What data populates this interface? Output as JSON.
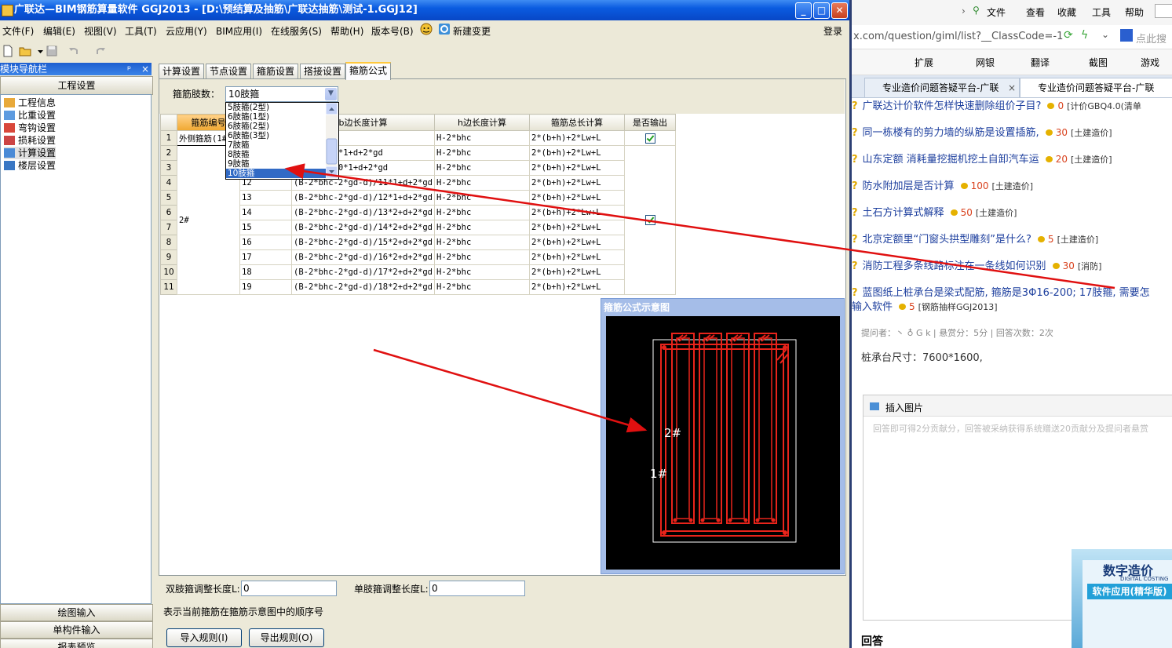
{
  "app": {
    "title": "广联达—BIM钢筋算量软件 GGJ2013 - [D:\\预结算及抽筋\\广联达抽筋\\测试-1.GGJ12]",
    "win_min": "_",
    "win_max": "□",
    "win_close": "✕",
    "menu": [
      "文件(F)",
      "编辑(E)",
      "视图(V)",
      "工具(T)",
      "云应用(Y)",
      "BIM应用(I)",
      "在线服务(S)",
      "帮助(H)",
      "版本号(B)",
      "新建变更"
    ],
    "login": "登录",
    "nav": {
      "header": "模块导航栏",
      "pin": "ᵖ",
      "close": "×",
      "group": "工程设置",
      "items": [
        "工程信息",
        "比重设置",
        "弯钩设置",
        "损耗设置",
        "计算设置",
        "楼层设置"
      ],
      "bottom": [
        "绘图输入",
        "单构件输入",
        "报表预览"
      ]
    },
    "tabs": [
      "计算设置",
      "节点设置",
      "箍筋设置",
      "搭接设置",
      "箍筋公式"
    ],
    "limbs_label": "箍筋肢数：",
    "limbs_value": "10肢箍",
    "dropdown_options": [
      "5肢箍(2型)",
      "6肢箍(1型)",
      "6肢箍(2型)",
      "6肢箍(3型)",
      "7肢箍",
      "8肢箍",
      "9肢箍",
      "10肢箍"
    ],
    "grid": {
      "headers": [
        "箍筋编号",
        "",
        "b边长度计算",
        "h边长度计算",
        "箍筋总长计算",
        "是否输出"
      ],
      "rows": [
        {
          "n": "1",
          "id": "外侧箍筋(1#)",
          "p": "",
          "b": "",
          "h": "H-2*bhc",
          "t": "2*(b+h)+2*Lw+L"
        },
        {
          "n": "2",
          "id": "",
          "p": "",
          "b": "2*gd-d)/9*1+d+2*gd",
          "h": "H-2*bhc",
          "t": "2*(b+h)+2*Lw+L"
        },
        {
          "n": "3",
          "id": "",
          "p": "",
          "b": "2*gd-d)/10*1+d+2*gd",
          "h": "H-2*bhc",
          "t": "2*(b+h)+2*Lw+L"
        },
        {
          "n": "4",
          "id": "",
          "p": "12",
          "b": "(B-2*bhc-2*gd-d)/11*1+d+2*gd",
          "h": "H-2*bhc",
          "t": "2*(b+h)+2*Lw+L"
        },
        {
          "n": "5",
          "id": "",
          "p": "13",
          "b": "(B-2*bhc-2*gd-d)/12*1+d+2*gd",
          "h": "H-2*bhc",
          "t": "2*(b+h)+2*Lw+L"
        },
        {
          "n": "6",
          "id": "2#",
          "p": "14",
          "b": "(B-2*bhc-2*gd-d)/13*2+d+2*gd",
          "h": "H-2*bhc",
          "t": "2*(b+h)+2*Lw+L"
        },
        {
          "n": "7",
          "id": "",
          "p": "15",
          "b": "(B-2*bhc-2*gd-d)/14*2+d+2*gd",
          "h": "H-2*bhc",
          "t": "2*(b+h)+2*Lw+L"
        },
        {
          "n": "8",
          "id": "",
          "p": "16",
          "b": "(B-2*bhc-2*gd-d)/15*2+d+2*gd",
          "h": "H-2*bhc",
          "t": "2*(b+h)+2*Lw+L"
        },
        {
          "n": "9",
          "id": "",
          "p": "17",
          "b": "(B-2*bhc-2*gd-d)/16*2+d+2*gd",
          "h": "H-2*bhc",
          "t": "2*(b+h)+2*Lw+L"
        },
        {
          "n": "10",
          "id": "",
          "p": "18",
          "b": "(B-2*bhc-2*gd-d)/17*2+d+2*gd",
          "h": "H-2*bhc",
          "t": "2*(b+h)+2*Lw+L"
        },
        {
          "n": "11",
          "id": "",
          "p": "19",
          "b": "(B-2*bhc-2*gd-d)/18*2+d+2*gd",
          "h": "H-2*bhc",
          "t": "2*(b+h)+2*Lw+L"
        }
      ]
    },
    "diagram": {
      "title": "箍筋公式示意图",
      "label_outer": "1#",
      "label_inner": "2#"
    },
    "double_adjust_label": "双肢箍调整长度L:",
    "double_adjust_value": "0",
    "single_adjust_label": "单肢箍调整长度L:",
    "single_adjust_value": "0",
    "hint": "表示当前箍筋在箍筋示意图中的顺序号",
    "import_btn": "导入规则(I)",
    "export_btn": "导出规则(O)"
  },
  "browser": {
    "top_menu": [
      "文件",
      "查看",
      "收藏",
      "工具",
      "帮助"
    ],
    "address": "x.com/question/giml/list?__ClassCode=-1",
    "address_right": "点此搜",
    "tools": [
      "扩展",
      "网银",
      "翻译",
      "截图",
      "游戏"
    ],
    "tabs": [
      "专业造价问题答疑平台-广联",
      "专业造价问题答疑平台-广联"
    ],
    "questions": [
      {
        "title": "广联达计价软件怎样快速删除组价子目?",
        "pts": "0",
        "cat": "[计价GBQ4.0(清单"
      },
      {
        "title": "同一栋楼有的剪力墙的纵筋是设置插筋,",
        "pts": "30",
        "cat": "[土建造价]"
      },
      {
        "title": "山东定额 消耗量挖掘机挖土自卸汽车运",
        "pts": "20",
        "cat": "[土建造价]"
      },
      {
        "title": "防水附加层是否计算",
        "pts": "100",
        "cat": "[土建造价]"
      },
      {
        "title": "土石方计算式解释",
        "pts": "50",
        "cat": "[土建造价]"
      },
      {
        "title": "北京定额里“门窗头拱型雕刻”是什么?",
        "pts": "5",
        "cat": "[土建造价]"
      },
      {
        "title": "消防工程多条线路标注在一条线如何识别",
        "pts": "30",
        "cat": "[消防]"
      },
      {
        "title": "蓝图纸上桩承台是梁式配筋, 箍筋是3Φ16-200; 17肢箍, 需要怎",
        "pts": "",
        "cat": ""
      }
    ],
    "q_tail": "输入软件",
    "q_tail_pts": "5",
    "q_tail_cat": "[钢筋抽样GGJ2013]",
    "meta": "提问者：丶 ♁ G k  |  悬赏分：5分  |  回答次数：2次",
    "body": "桩承台尺寸：7600*1600,",
    "insert_image": "插入图片",
    "placeholder": "回答即可得2分贡献分，回答被采纳获得系统赠送20贡献分及提问者悬赏",
    "answer_label": "回答",
    "ad_title": "数字造价",
    "ad_sub": "DIGITAL COSTING",
    "ad_banner": "软件应用(精华版)"
  },
  "colors": {
    "rebar": "#e8241b",
    "arrow": "#e01010",
    "selection": "#316ac5"
  }
}
